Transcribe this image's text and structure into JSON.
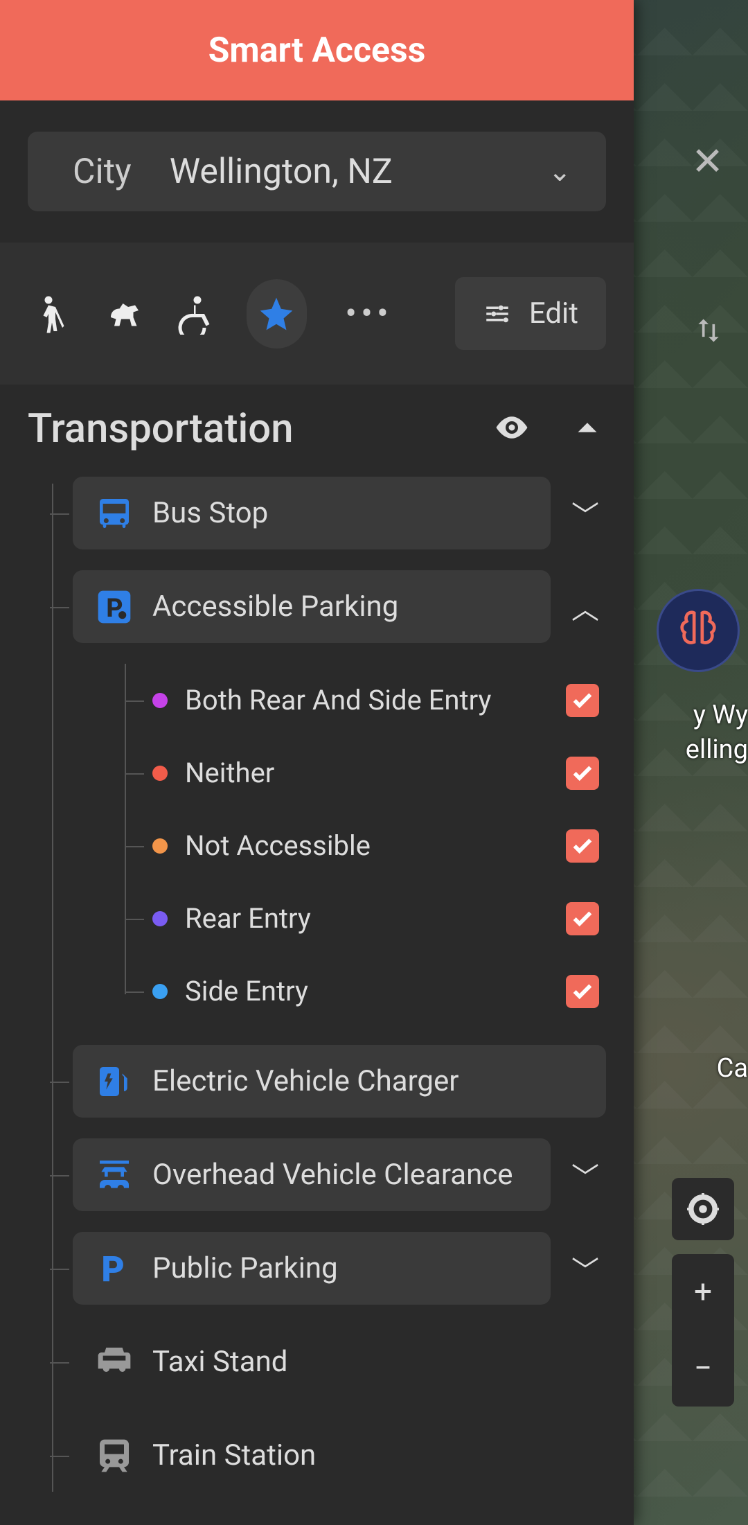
{
  "app": {
    "title": "Smart Access"
  },
  "city_selector": {
    "label": "City",
    "value": "Wellington, NZ"
  },
  "toolbar": {
    "edit_label": "Edit",
    "icons": [
      {
        "name": "cane-walker-icon"
      },
      {
        "name": "guide-dog-icon"
      },
      {
        "name": "wheelchair-icon"
      },
      {
        "name": "star-icon",
        "active": true
      },
      {
        "name": "more-icon"
      }
    ]
  },
  "section": {
    "title": "Transportation"
  },
  "categories": [
    {
      "id": "bus-stop",
      "label": "Bus Stop",
      "icon": "bus-icon",
      "color": "#2f7fe6",
      "expanded": false,
      "pill": true,
      "chev": true
    },
    {
      "id": "accessible-parking",
      "label": "Accessible Parking",
      "icon": "parking-accessible-icon",
      "color": "#2f7fe6",
      "expanded": true,
      "pill": true,
      "chev": true,
      "children": [
        {
          "label": "Both Rear And Side Entry",
          "dot": "#c542e8",
          "checked": true
        },
        {
          "label": "Neither",
          "dot": "#f25c4a",
          "checked": true
        },
        {
          "label": "Not Accessible",
          "dot": "#f2954a",
          "checked": true
        },
        {
          "label": "Rear Entry",
          "dot": "#7a5cf2",
          "checked": true
        },
        {
          "label": "Side Entry",
          "dot": "#3aa0f2",
          "checked": true
        }
      ]
    },
    {
      "id": "ev-charger",
      "label": "Electric Vehicle Charger",
      "icon": "ev-icon",
      "color": "#2f7fe6",
      "expanded": false,
      "pill": true,
      "chev": false
    },
    {
      "id": "overhead-clearance",
      "label": "Overhead Vehicle Clearance",
      "icon": "clearance-icon",
      "color": "#2f7fe6",
      "expanded": false,
      "pill": true,
      "chev": true
    },
    {
      "id": "public-parking",
      "label": "Public Parking",
      "icon": "parking-icon",
      "color": "#2f7fe6",
      "expanded": false,
      "pill": true,
      "chev": true
    },
    {
      "id": "taxi-stand",
      "label": "Taxi Stand",
      "icon": "taxi-icon",
      "color": "#999",
      "expanded": false,
      "pill": false,
      "chev": false
    },
    {
      "id": "train-station",
      "label": "Train Station",
      "icon": "train-icon",
      "color": "#999",
      "expanded": false,
      "pill": false,
      "chev": false
    }
  ],
  "map_controls": {
    "locate": "locate-icon",
    "zoom_in": "+",
    "zoom_out": "−"
  },
  "map_peek_labels": [
    "y Wy",
    "elling",
    "Ca"
  ]
}
